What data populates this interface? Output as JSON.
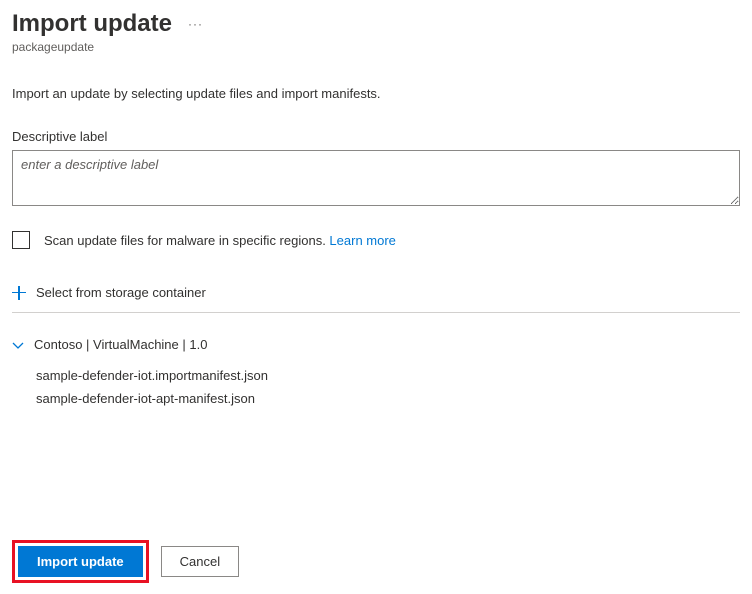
{
  "header": {
    "title": "Import update",
    "subtitle": "packageupdate"
  },
  "intro": "Import an update by selecting update files and import manifests.",
  "descriptive": {
    "label": "Descriptive label",
    "placeholder": "enter a descriptive label"
  },
  "scan": {
    "text": "Scan update files for malware in specific regions. ",
    "link": "Learn more"
  },
  "storage": {
    "select_label": "Select from storage container"
  },
  "group": {
    "title": "Contoso | VirtualMachine | 1.0",
    "files": [
      "sample-defender-iot.importmanifest.json",
      "sample-defender-iot-apt-manifest.json"
    ]
  },
  "buttons": {
    "import": "Import update",
    "cancel": "Cancel"
  }
}
